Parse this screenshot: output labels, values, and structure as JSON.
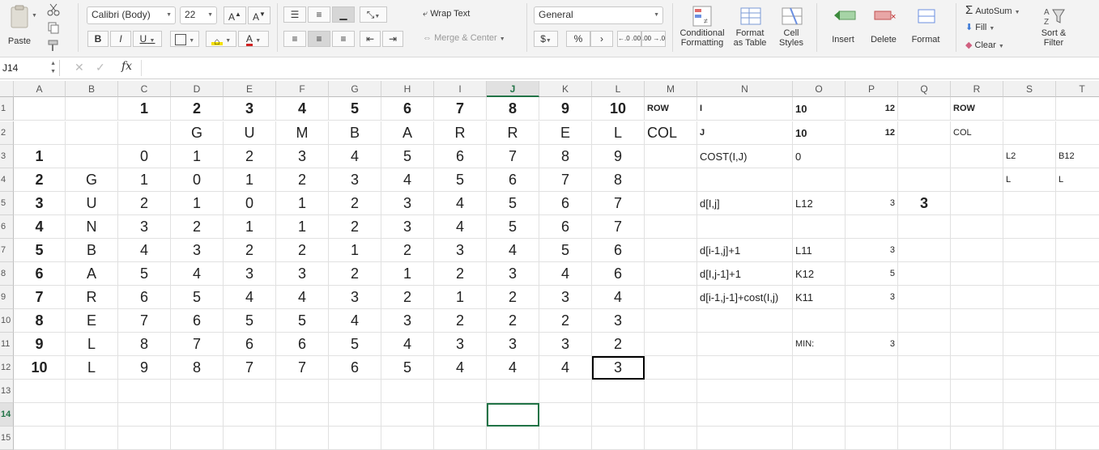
{
  "ribbon": {
    "paste_label": "Paste",
    "font_name": "Calibri (Body)",
    "font_size": "22",
    "bold": "B",
    "italic": "I",
    "underline": "U",
    "wrap_text": "Wrap Text",
    "merge_center": "Merge & Center",
    "number_format": "General",
    "currency": "$",
    "percent": "%",
    "comma": "›",
    "inc_decimal": "←.0 .00",
    "dec_decimal": ".00 →.0",
    "conditional_formatting": [
      "Conditional",
      "Formatting"
    ],
    "format_as_table": [
      "Format",
      "as Table"
    ],
    "cell_styles": [
      "Cell",
      "Styles"
    ],
    "insert": "Insert",
    "delete": "Delete",
    "format": "Format",
    "autosum": "AutoSum",
    "fill": "Fill",
    "clear": "Clear",
    "sort_filter": [
      "Sort &",
      "Filter"
    ]
  },
  "formula_bar": {
    "name_box": "J14",
    "fx": "fx",
    "content": ""
  },
  "columns": [
    "A",
    "B",
    "C",
    "D",
    "E",
    "F",
    "G",
    "H",
    "I",
    "J",
    "K",
    "L",
    "M",
    "N",
    "O",
    "P",
    "Q",
    "R",
    "S",
    "T"
  ],
  "selected_column": "J",
  "selected_row": "14",
  "rows": [
    [
      "",
      "",
      "1",
      "2",
      "3",
      "4",
      "5",
      "6",
      "7",
      "8",
      "9",
      "10",
      "ROW",
      "I",
      "10",
      "12",
      "",
      "ROW",
      "",
      ""
    ],
    [
      "",
      "",
      "",
      "G",
      "U",
      "M",
      "B",
      "A",
      "R",
      "R",
      "E",
      "L",
      "COL",
      "J",
      "10",
      "12",
      "",
      "COL",
      "",
      ""
    ],
    [
      "1",
      "",
      "0",
      "1",
      "2",
      "3",
      "4",
      "5",
      "6",
      "7",
      "8",
      "9",
      "",
      "COST(I,J)",
      "0",
      "",
      "",
      "",
      "L2",
      "B12"
    ],
    [
      "2",
      "G",
      "1",
      "0",
      "1",
      "2",
      "3",
      "4",
      "5",
      "6",
      "7",
      "8",
      "",
      "",
      "",
      "",
      "",
      "",
      "L",
      "L"
    ],
    [
      "3",
      "U",
      "2",
      "1",
      "0",
      "1",
      "2",
      "3",
      "4",
      "5",
      "6",
      "7",
      "",
      "d[I,j]",
      "L12",
      "3",
      "3",
      "",
      "",
      ""
    ],
    [
      "4",
      "N",
      "3",
      "2",
      "1",
      "1",
      "2",
      "3",
      "4",
      "5",
      "6",
      "7",
      "",
      "",
      "",
      "",
      "",
      "",
      "",
      ""
    ],
    [
      "5",
      "B",
      "4",
      "3",
      "2",
      "2",
      "1",
      "2",
      "3",
      "4",
      "5",
      "6",
      "",
      "d[i-1,j]+1",
      "L11",
      "3",
      "",
      "",
      "",
      ""
    ],
    [
      "6",
      "A",
      "5",
      "4",
      "3",
      "3",
      "2",
      "1",
      "2",
      "3",
      "4",
      "6",
      "",
      "d[I,j-1]+1",
      "K12",
      "5",
      "",
      "",
      "",
      ""
    ],
    [
      "7",
      "R",
      "6",
      "5",
      "4",
      "4",
      "3",
      "2",
      "1",
      "2",
      "3",
      "4",
      "",
      "d[i-1,j-1]+cost(I,j)",
      "K11",
      "3",
      "",
      "",
      "",
      ""
    ],
    [
      "8",
      "E",
      "7",
      "6",
      "5",
      "5",
      "4",
      "3",
      "2",
      "2",
      "2",
      "3",
      "",
      "",
      "",
      "",
      "",
      "",
      "",
      ""
    ],
    [
      "9",
      "L",
      "8",
      "7",
      "6",
      "6",
      "5",
      "4",
      "3",
      "3",
      "3",
      "2",
      "",
      "",
      "MIN:",
      "3",
      "",
      "",
      "",
      ""
    ],
    [
      "10",
      "L",
      "9",
      "8",
      "7",
      "7",
      "6",
      "5",
      "4",
      "4",
      "4",
      "3",
      "",
      "",
      "",
      "",
      "",
      "",
      "",
      ""
    ],
    [
      "",
      "",
      "",
      "",
      "",
      "",
      "",
      "",
      "",
      "",
      "",
      "",
      "",
      "",
      "",
      "",
      "",
      "",
      "",
      ""
    ],
    [
      "",
      "",
      "",
      "",
      "",
      "",
      "",
      "",
      "",
      "",
      "",
      "",
      "",
      "",
      "",
      "",
      "",
      "",
      "",
      ""
    ],
    [
      "",
      "",
      "",
      "",
      "",
      "",
      "",
      "",
      "",
      "",
      "",
      "",
      "",
      "",
      "",
      "",
      "",
      "",
      "",
      ""
    ]
  ],
  "row_numbers": [
    "1",
    "2",
    "3",
    "4",
    "5",
    "6",
    "7",
    "8",
    "9",
    "10",
    "11",
    "12",
    "13",
    "14",
    "15"
  ]
}
